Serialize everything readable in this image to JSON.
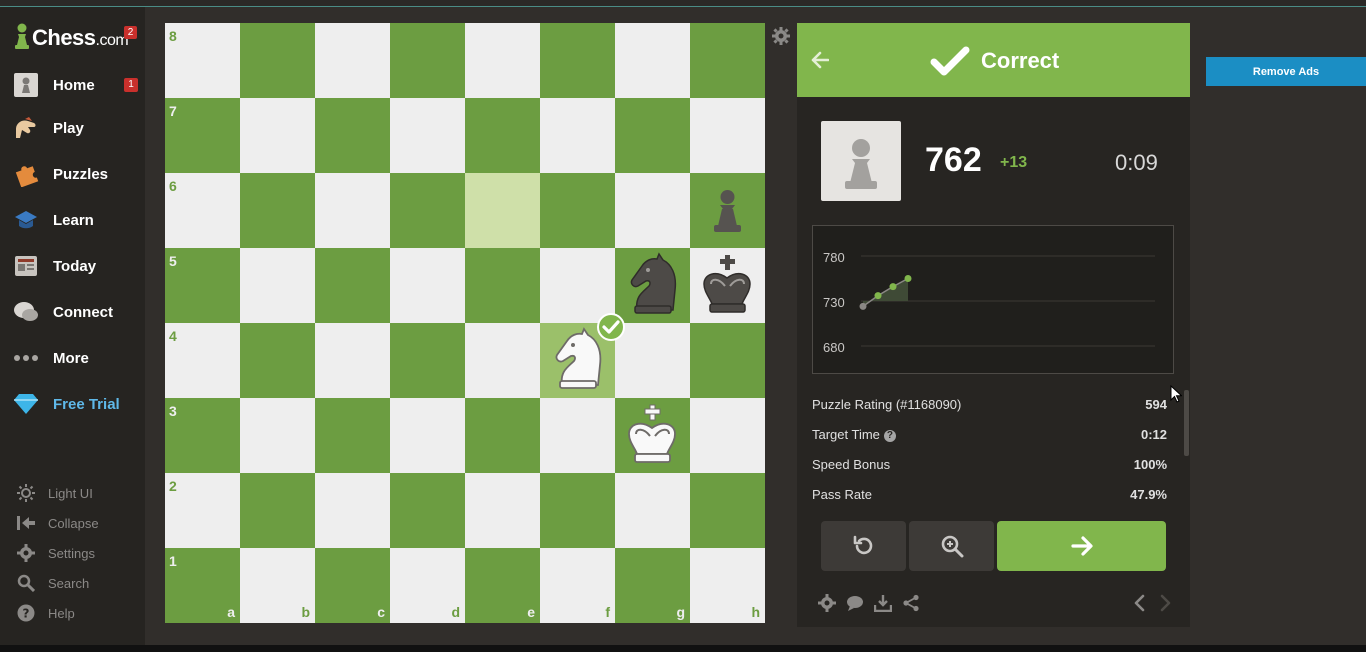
{
  "app": {
    "logo_text": "Chess",
    "logo_suffix": ".com",
    "logo_badge": "2"
  },
  "sidebar": {
    "items": [
      {
        "label": "Home",
        "icon": "home-pawn-icon",
        "badge": "1"
      },
      {
        "label": "Play",
        "icon": "play-hand-icon"
      },
      {
        "label": "Puzzles",
        "icon": "puzzle-piece-icon"
      },
      {
        "label": "Learn",
        "icon": "graduation-cap-icon"
      },
      {
        "label": "Today",
        "icon": "newspaper-icon"
      },
      {
        "label": "Connect",
        "icon": "chat-bubbles-icon"
      },
      {
        "label": "More",
        "icon": "more-dots-icon"
      },
      {
        "label": "Free Trial",
        "icon": "diamond-icon"
      }
    ],
    "utilities": [
      {
        "label": "Light UI",
        "icon": "sun-icon"
      },
      {
        "label": "Collapse",
        "icon": "collapse-arrow-icon"
      },
      {
        "label": "Settings",
        "icon": "gear-icon"
      },
      {
        "label": "Search",
        "icon": "search-icon"
      },
      {
        "label": "Help",
        "icon": "help-icon"
      }
    ]
  },
  "board": {
    "ranks": [
      "8",
      "7",
      "6",
      "5",
      "4",
      "3",
      "2",
      "1"
    ],
    "files": [
      "a",
      "b",
      "c",
      "d",
      "e",
      "f",
      "g",
      "h"
    ],
    "highlighted_squares": [
      "e6",
      "f4"
    ],
    "pieces": [
      {
        "square": "h6",
        "piece": "black-pawn"
      },
      {
        "square": "g5",
        "piece": "black-knight"
      },
      {
        "square": "h5",
        "piece": "black-king"
      },
      {
        "square": "f4",
        "piece": "white-knight"
      },
      {
        "square": "g3",
        "piece": "white-king"
      }
    ],
    "correct_move_square": "f4"
  },
  "panel": {
    "header_label": "Correct",
    "rating": "762",
    "rating_delta": "+13",
    "timer": "0:09",
    "graph": {
      "y_ticks": [
        "780",
        "730",
        "680"
      ],
      "points": [
        724,
        736,
        746,
        755
      ]
    },
    "stats": [
      {
        "label": "Puzzle Rating (#1168090)",
        "value": "594"
      },
      {
        "label": "Target Time",
        "value": "0:12",
        "help": "?"
      },
      {
        "label": "Speed Bonus",
        "value": "100%"
      },
      {
        "label": "Pass Rate",
        "value": "47.9%"
      }
    ]
  },
  "ads": {
    "remove_label": "Remove Ads"
  },
  "colors": {
    "board_light": "#eeeeee",
    "board_dark": "#6c9d41",
    "accent_green": "#81b64c",
    "ads_blue": "#1b8ec4"
  }
}
